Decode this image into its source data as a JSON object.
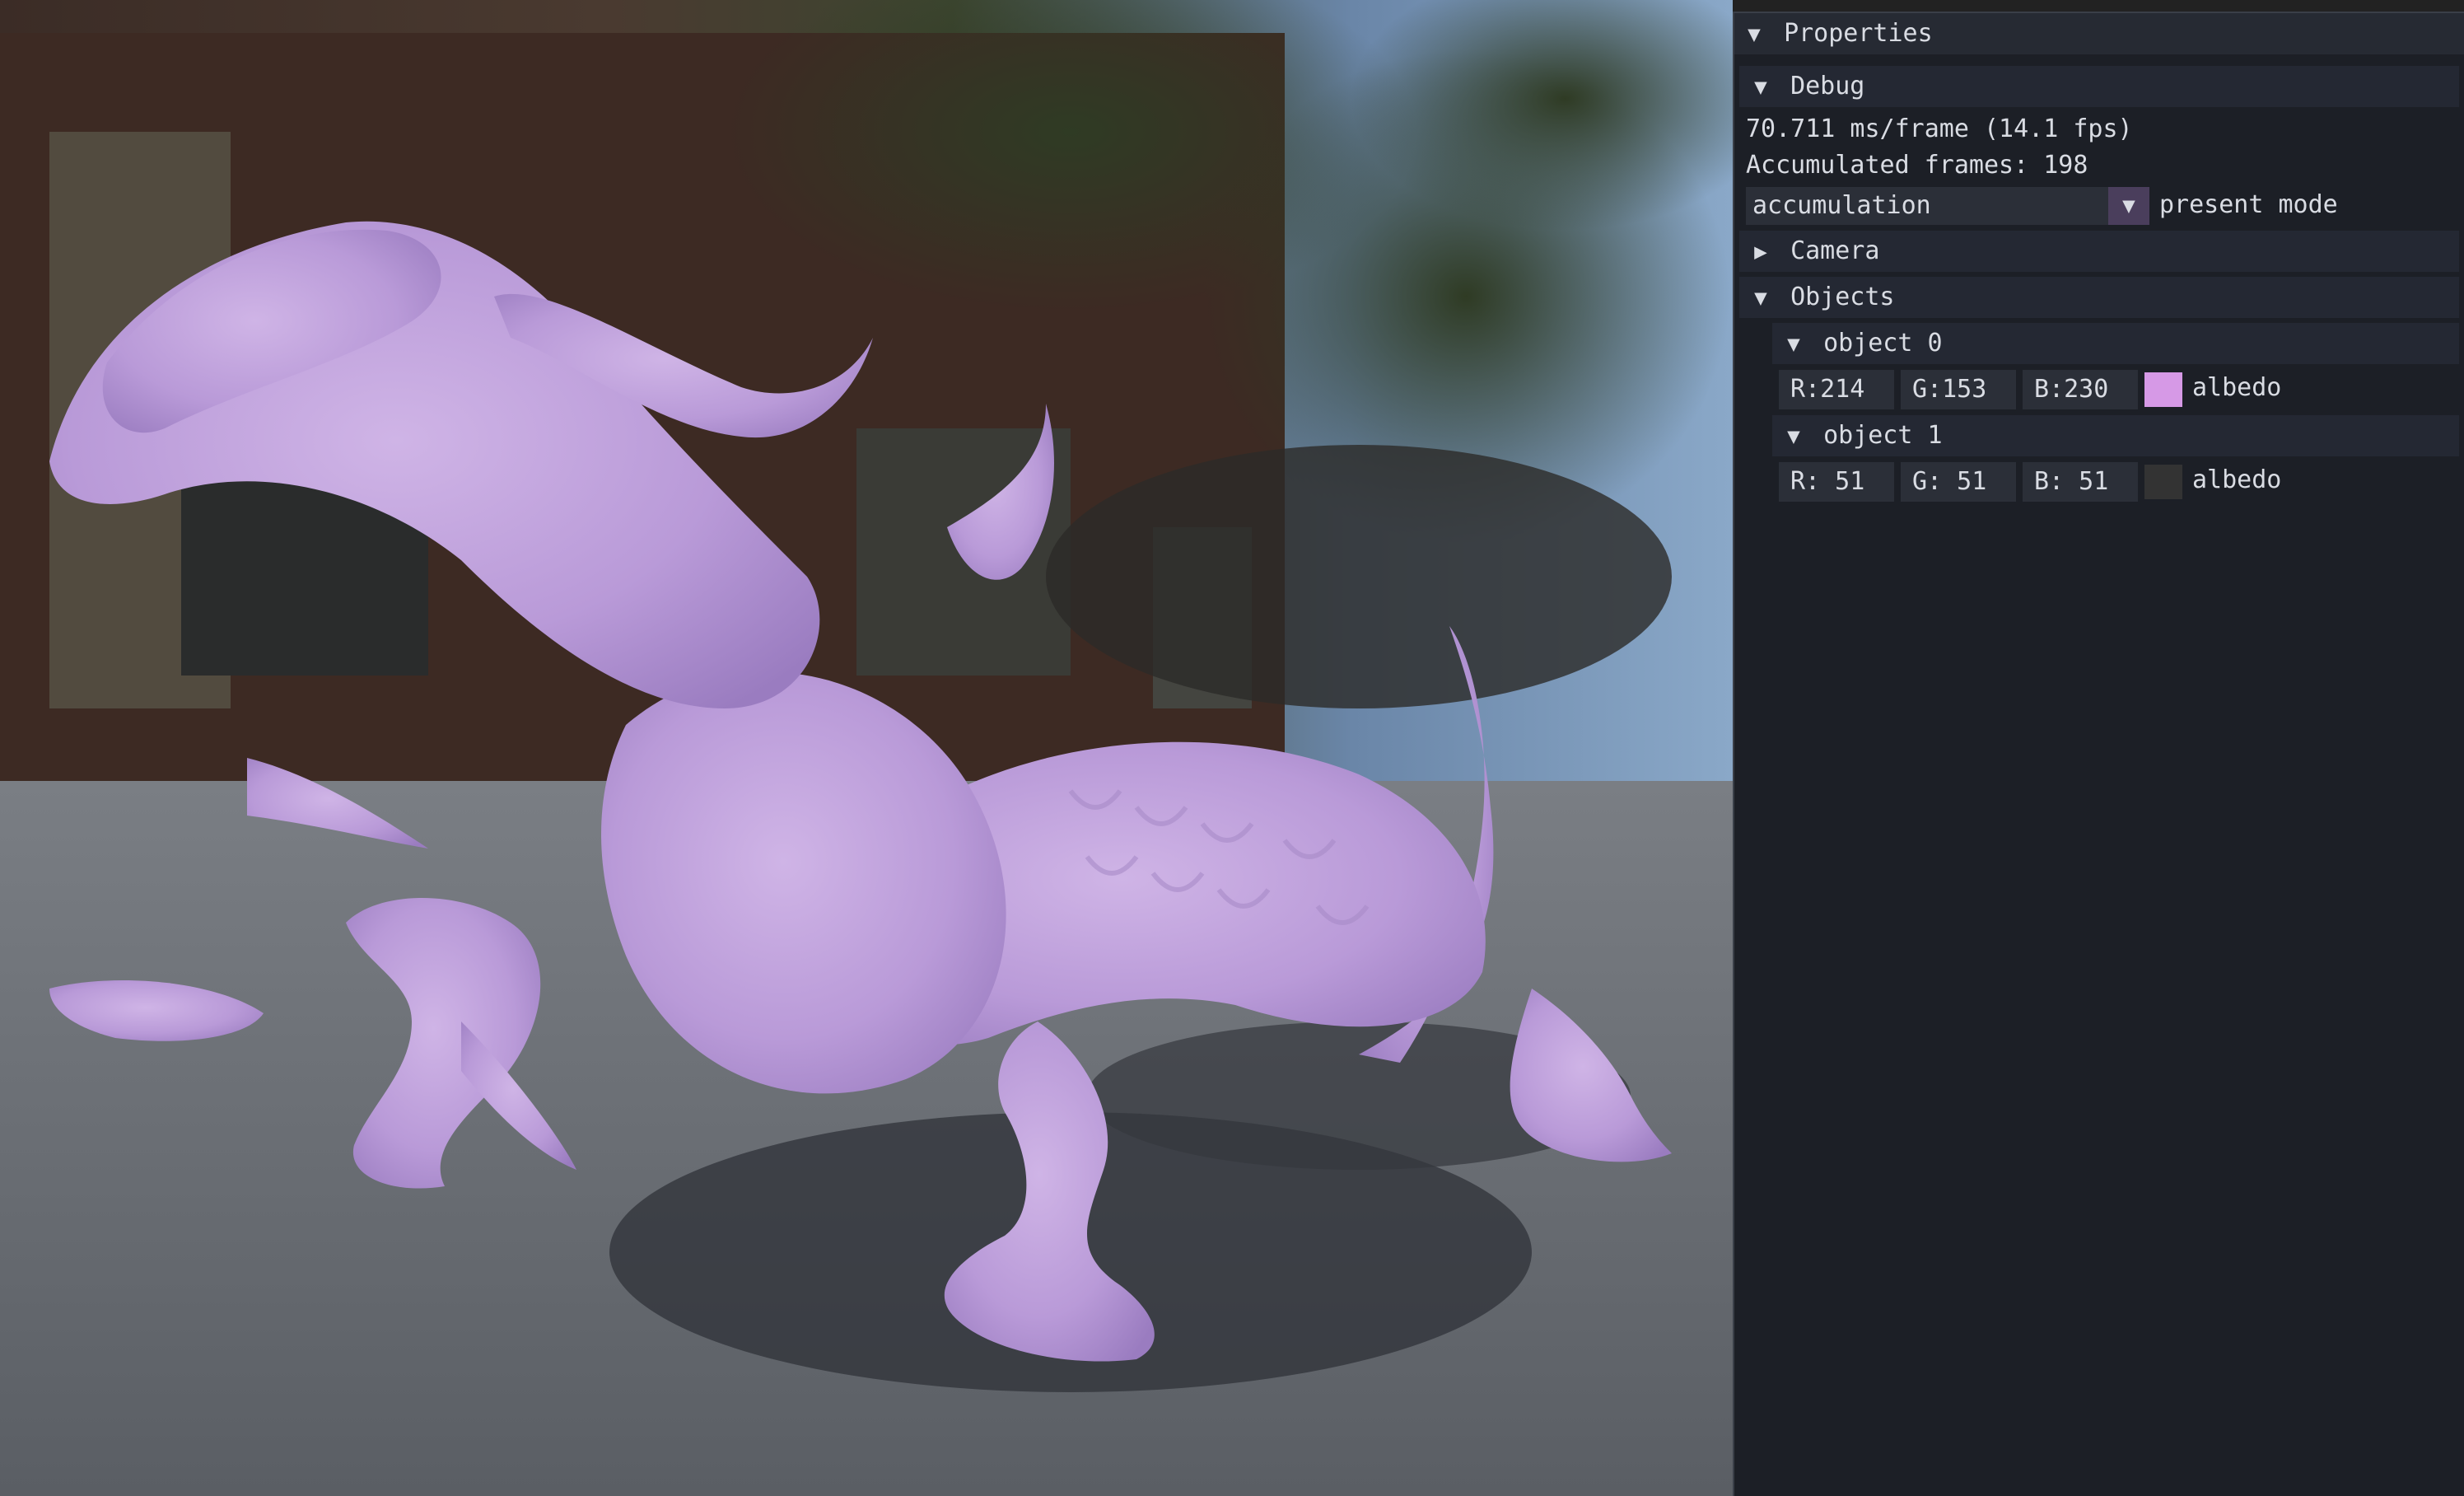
{
  "panel": {
    "title": "Properties",
    "debug": {
      "title": "Debug",
      "frame_time": "70.711 ms/frame (14.1 fps)",
      "accumulated": "Accumulated frames: 198",
      "mode_value": "accumulation",
      "mode_label": "present mode"
    },
    "camera": {
      "title": "Camera"
    },
    "objects": {
      "title": "Objects",
      "items": [
        {
          "title": "object 0",
          "r": "R:214",
          "g": "G:153",
          "b": "B:230",
          "color": "#d699e6",
          "label": "albedo"
        },
        {
          "title": "object 1",
          "r": "R: 51",
          "g": "G: 51",
          "b": "B: 51",
          "color": "#333333",
          "label": "albedo"
        }
      ]
    }
  },
  "colors": {
    "panel_bg": "#1c1f26",
    "header_bg": "#242833",
    "field_bg": "#2b2f38",
    "combo_arrow_bg": "#4a3e5c"
  },
  "icons": {
    "expanded": "triangle-down-icon",
    "collapsed": "triangle-right-icon"
  }
}
